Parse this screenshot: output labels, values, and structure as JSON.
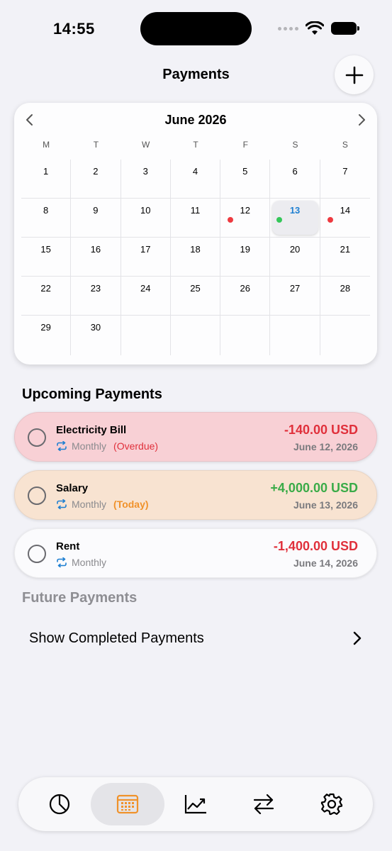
{
  "status": {
    "time": "14:55"
  },
  "header": {
    "title": "Payments"
  },
  "calendar": {
    "month": "June 2026",
    "weekdays": [
      "M",
      "T",
      "W",
      "T",
      "F",
      "S",
      "S"
    ],
    "days": [
      "1",
      "2",
      "3",
      "4",
      "5",
      "6",
      "7",
      "8",
      "9",
      "10",
      "11",
      "12",
      "13",
      "14",
      "15",
      "16",
      "17",
      "18",
      "19",
      "20",
      "21",
      "22",
      "23",
      "24",
      "25",
      "26",
      "27",
      "28",
      "29",
      "30"
    ],
    "selected_day": "13"
  },
  "upcoming": {
    "title": "Upcoming Payments",
    "items": [
      {
        "name": "Electricity Bill",
        "frequency": "Monthly",
        "tag": "(Overdue)",
        "amount": "-140.00 USD",
        "date": "June 12, 2026"
      },
      {
        "name": "Salary",
        "frequency": "Monthly",
        "tag": "(Today)",
        "amount": "+4,000.00 USD",
        "date": "June 13, 2026"
      },
      {
        "name": "Rent",
        "frequency": "Monthly",
        "tag": "",
        "amount": "-1,400.00 USD",
        "date": "June 14, 2026"
      }
    ]
  },
  "future": {
    "title": "Future Payments"
  },
  "show_completed": {
    "label": "Show Completed Payments"
  },
  "colors": {
    "accent": "#f0922b",
    "overdue_bg": "#f8d0d5",
    "today_bg": "#f8e3d1",
    "negative": "#e0303b",
    "positive": "#3aab48",
    "selected_day": "#1e7fd1"
  },
  "tabbar": {
    "icons": [
      "pie-chart-icon",
      "calendar-icon",
      "chart-line-icon",
      "transfer-icon",
      "gear-icon"
    ],
    "active": "calendar-icon"
  }
}
